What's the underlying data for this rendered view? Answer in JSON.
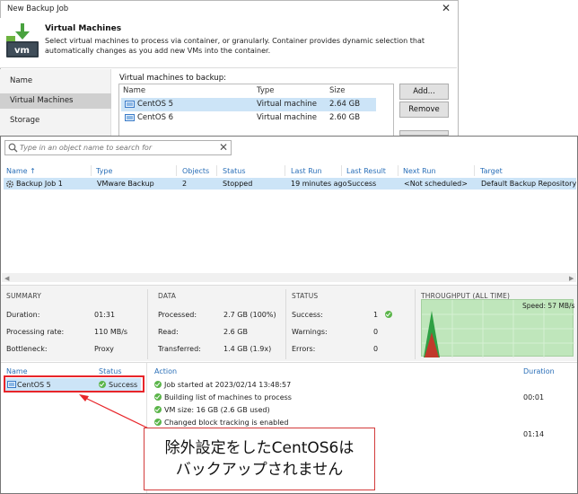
{
  "wizard": {
    "title": "New Backup Job",
    "close_glyph": "✕",
    "heading": "Virtual Machines",
    "description": "Select virtual machines to process via container, or granularly. Container provides dynamic selection that automatically changes as you add new VMs into the container.",
    "icon_text": "vm",
    "nav": [
      {
        "label": "Name",
        "selected": false
      },
      {
        "label": "Virtual Machines",
        "selected": true
      },
      {
        "label": "Storage",
        "selected": false
      }
    ],
    "list_label": "Virtual machines to backup:",
    "columns": [
      "Name",
      "Type",
      "Size"
    ],
    "rows": [
      {
        "name": "CentOS 5",
        "type": "Virtual machine",
        "size": "2.64 GB"
      },
      {
        "name": "CentOS 6",
        "type": "Virtual machine",
        "size": "2.60 GB"
      }
    ],
    "buttons": {
      "add": "Add...",
      "remove": "Remove"
    }
  },
  "search": {
    "placeholder": "Type in an object name to search for",
    "clear_glyph": "✕"
  },
  "jobs": {
    "columns": [
      "Name",
      "Type",
      "Objects",
      "Status",
      "Last Run",
      "Last Result",
      "Next Run",
      "Target"
    ],
    "sort_glyph": "↑",
    "rows": [
      {
        "name": "Backup Job 1",
        "type": "VMware Backup",
        "objects": "2",
        "status": "Stopped",
        "last_run": "19 minutes ago",
        "last_result": "Success",
        "next_run": "<Not scheduled>",
        "target": "Default Backup Repository"
      }
    ]
  },
  "summary": {
    "title": "SUMMARY",
    "items": [
      {
        "k": "Duration:",
        "v": "01:31"
      },
      {
        "k": "Processing rate:",
        "v": "110 MB/s"
      },
      {
        "k": "Bottleneck:",
        "v": "Proxy"
      }
    ]
  },
  "data_section": {
    "title": "DATA",
    "items": [
      {
        "k": "Processed:",
        "v": "2.7 GB (100%)"
      },
      {
        "k": "Read:",
        "v": "2.6 GB"
      },
      {
        "k": "Transferred:",
        "v": "1.4 GB (1.9x)"
      }
    ]
  },
  "status_section": {
    "title": "STATUS",
    "items": [
      {
        "k": "Success:",
        "v": "1"
      },
      {
        "k": "Warnings:",
        "v": "0"
      },
      {
        "k": "Errors:",
        "v": "0"
      }
    ]
  },
  "throughput": {
    "title": "THROUGHPUT (ALL TIME)",
    "speed": "Speed: 57 MB/s",
    "colors": {
      "bg": "#bfe6bb",
      "read": "#c0392b",
      "process": "#2ea043"
    }
  },
  "vm_status": {
    "columns": [
      "Name",
      "Status"
    ],
    "rows": [
      {
        "name": "CentOS 5",
        "status": "Success"
      }
    ]
  },
  "actions": {
    "columns": [
      "Action",
      "Duration"
    ],
    "rows": [
      {
        "text": "Job started at 2023/02/14 13:48:57",
        "duration": ""
      },
      {
        "text": "Building list of machines to process",
        "duration": "00:01"
      },
      {
        "text": "VM size: 16 GB (2.6 GB used)",
        "duration": ""
      },
      {
        "text": "Changed block tracking is enabled",
        "duration": ""
      },
      {
        "text": "",
        "duration": "01:14"
      }
    ]
  },
  "annotation": {
    "line1": "除外設定をしたCentOS6は",
    "line2": "バックアップされません",
    "color": "#e8252a"
  }
}
